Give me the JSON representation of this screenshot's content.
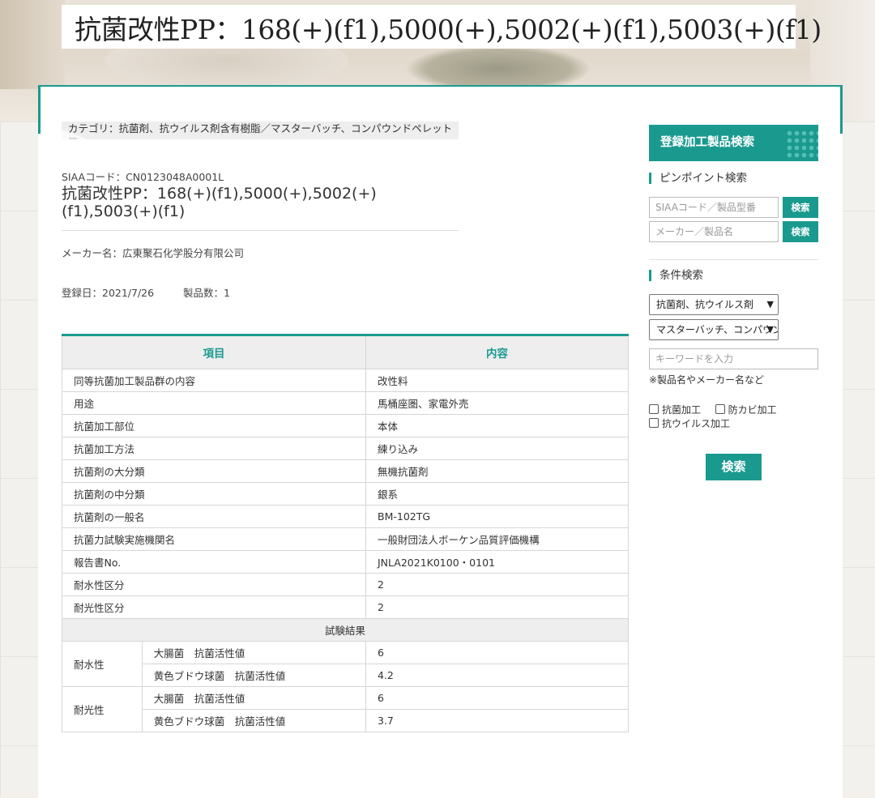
{
  "banner": {
    "title": "抗菌改性PP：168(+)(f1),5000(+),5002(+)(f1),5003(+)(f1)"
  },
  "product": {
    "category": "カテゴリ：抗菌剤、抗ウイルス剤含有樹脂／マスターバッチ、コンパウンドペレット等",
    "siaa_code": "SIAAコード：CN0123048A0001L",
    "title": "抗菌改性PP：168(+)(f1),5000(+),5002(+)(f1),5003(+)(f1)",
    "maker": "メーカー名：広東聚石化学股分有限公司",
    "registered": "登録日：2021/7/26",
    "product_count": "製品数：1"
  },
  "table": {
    "header_item": "項目",
    "header_content": "内容",
    "rows": [
      {
        "label": "同等抗菌加工製品群の内容",
        "value": "改性料"
      },
      {
        "label": "用途",
        "value": "馬桶座圏、家電外売"
      },
      {
        "label": "抗菌加工部位",
        "value": "本体"
      },
      {
        "label": "抗菌加工方法",
        "value": "練り込み"
      },
      {
        "label": "抗菌剤の大分類",
        "value": "無機抗菌剤"
      },
      {
        "label": "抗菌剤の中分類",
        "value": "銀系"
      },
      {
        "label": "抗菌剤の一般名",
        "value": "BM-102TG"
      },
      {
        "label": "抗菌力試験実施機関名",
        "value": "一般財団法人ボーケン品質評価機構"
      },
      {
        "label": "報告書No.",
        "value": "JNLA2021K0100・0101"
      },
      {
        "label": "耐水性区分",
        "value": "2"
      },
      {
        "label": "耐光性区分",
        "value": "2"
      }
    ],
    "results_heading": "試験結果",
    "results": [
      {
        "group": "耐水性",
        "items": [
          {
            "name": "大腸菌　抗菌活性値",
            "value": "6"
          },
          {
            "name": "黄色ブドウ球菌　抗菌活性値",
            "value": "4.2"
          }
        ]
      },
      {
        "group": "耐光性",
        "items": [
          {
            "name": "大腸菌　抗菌活性値",
            "value": "6"
          },
          {
            "name": "黄色ブドウ球菌　抗菌活性値",
            "value": "3.7"
          }
        ]
      }
    ]
  },
  "sidebar": {
    "header": "登録加工製品検索",
    "pinpoint_title": "ピンポイント検索",
    "siaa_placeholder": "SIAAコード／製品型番",
    "maker_placeholder": "メーカー／製品名",
    "search_small": "検索",
    "condition_title": "条件検索",
    "select1_value": "抗菌剤、抗ウイルス剤",
    "select2_value": "マスターバッチ、コンパウンド",
    "keyword_placeholder": "キーワードを入力",
    "keyword_note": "※製品名やメーカー名など",
    "checkbox_antibacterial": "抗菌加工",
    "checkbox_antimold": "防カビ加工",
    "checkbox_antiviral": "抗ウイルス加工",
    "search_button": "検索"
  },
  "colors": {
    "accent": "#1a9a8f",
    "table_header_bg": "#eeeeee"
  }
}
